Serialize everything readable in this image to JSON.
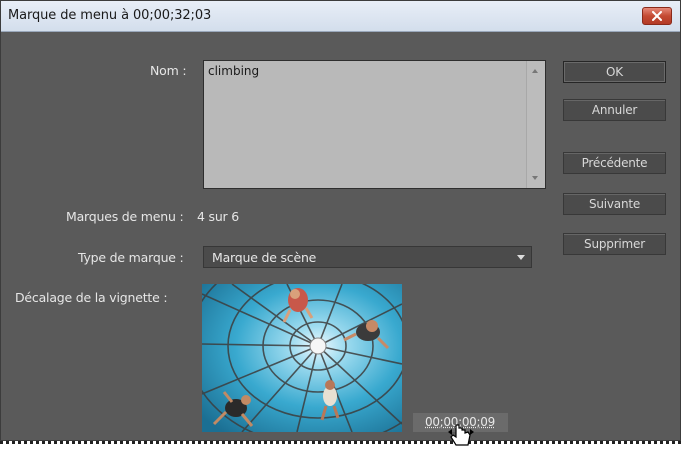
{
  "window": {
    "title": "Marque de menu à 00;00;32;03",
    "close_label": "✕"
  },
  "form": {
    "name_label": "Nom :",
    "name_value": "climbing",
    "markers_label": "Marques de menu :",
    "markers_value": "4 sur 6",
    "marker_type_label": "Type de marque :",
    "marker_type_value": "Marque de scène",
    "thumbnail_offset_label": "Décalage de la vignette :",
    "thumbnail_timecode": "00;00;00;09"
  },
  "buttons": {
    "ok": "OK",
    "cancel": "Annuler",
    "previous": "Précédente",
    "next": "Suivante",
    "delete": "Supprimer"
  },
  "colors": {
    "dialog_bg": "#5a5a5a",
    "titlebar": "#d3deec",
    "text_field_bg": "#b9b9b9",
    "close_button": "#c44a33"
  }
}
